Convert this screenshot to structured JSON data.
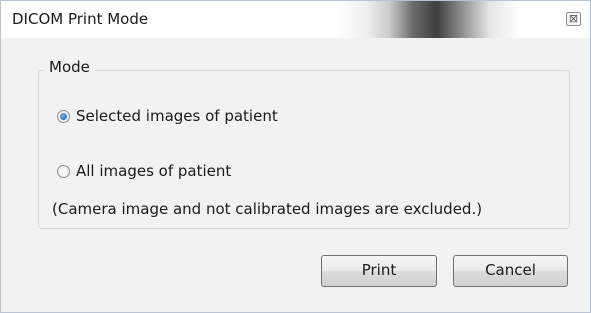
{
  "window": {
    "title": "DICOM Print Mode",
    "close_glyph": "⊠"
  },
  "mode_group": {
    "label": "Mode",
    "options": [
      {
        "label": "Selected images of patient",
        "checked": true
      },
      {
        "label": "All images of patient",
        "checked": false
      }
    ],
    "note": "(Camera image and not calibrated images are excluded.)"
  },
  "buttons": {
    "print": "Print",
    "cancel": "Cancel"
  }
}
